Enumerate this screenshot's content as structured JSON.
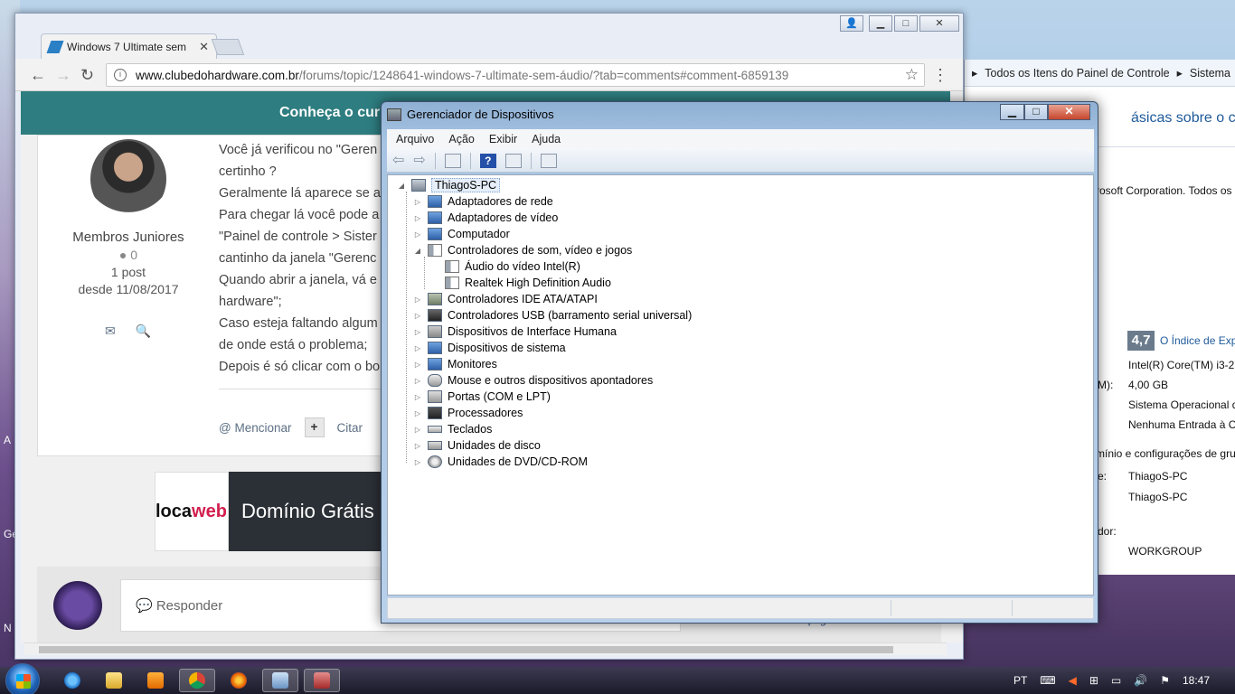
{
  "desktop": {
    "edge_labels": [
      "A",
      "Ge",
      "N"
    ]
  },
  "chrome": {
    "tab_title": "Windows 7 Ultimate sem",
    "tab_close": "✕",
    "url_host": "www.clubedohardware.com.br",
    "url_path": "/forums/topic/1248641-windows-7-ultimate-sem-áudio/?tab=comments#comment-6859139",
    "info_glyph": "i",
    "star_glyph": "☆",
    "menu_glyph": "⋮",
    "back_glyph": "←",
    "forward_glyph": "→",
    "reload_glyph": "↻",
    "win_user": "👤",
    "win_min": "▁",
    "win_max": "□",
    "win_close": "✕"
  },
  "page": {
    "banner_text": "Conheça o cur",
    "author": {
      "group": "Membros Juniores",
      "reputation": "0",
      "posts": "1 post",
      "since": "desde 11/08/2017",
      "mail_icon": "✉",
      "search_icon": "🔍"
    },
    "post_lines": [
      "Você já verificou no \"Geren",
      "certinho ?",
      "Geralmente lá aparece se a",
      "Para chegar lá você pode a",
      "\"Painel de controle > Sister",
      "cantinho da janela \"Gerenc",
      "Quando abrir a janela, vá e",
      "hardware\";",
      "Caso esteja faltando algum",
      "de onde está o problema;",
      "Depois é só clicar com o bo"
    ],
    "actions": {
      "mention": "@ Mencionar",
      "plus": "+",
      "quote": "Citar"
    },
    "ad": {
      "logo_a": "loca",
      "logo_b": "web",
      "slogan": "Domínio Grátis"
    },
    "reply_placeholder": "💬 Responder",
    "reply_extra": "da linha Rampage"
  },
  "control_panel": {
    "breadcrumb_1": "Todos os Itens do Painel de Controle",
    "breadcrumb_2": "Sistema",
    "heading": "ásicas sobre o compu",
    "copyright": "rosoft Corporation. Todos os",
    "index_score": "4,7",
    "index_link": "O Índice de Expe",
    "processor": "Intel(R) Core(TM) i3-21",
    "ram_label": "M):",
    "ram": "4,00 GB",
    "system_type": "Sistema Operacional d",
    "pen_touch": "Nenhuma Entrada à Ca",
    "domain_section": "mínio e configurações de gru",
    "computer_name_label": "e:",
    "computer_name": "ThiagoS-PC",
    "full_name": "ThiagoS-PC",
    "description_label": "dor:",
    "workgroup": "WORKGROUP"
  },
  "device_manager": {
    "title": "Gerenciador de Dispositivos",
    "min": "▁",
    "max": "□",
    "close": "✕",
    "menu": [
      "Arquivo",
      "Ação",
      "Exibir",
      "Ajuda"
    ],
    "toolbar_help": "?",
    "root": "ThiagoS-PC",
    "categories": [
      "Adaptadores de rede",
      "Adaptadores de vídeo",
      "Computador",
      "Controladores de som, vídeo e jogos",
      "Áudio do vídeo Intel(R)",
      "Realtek High Definition Audio",
      "Controladores IDE ATA/ATAPI",
      "Controladores USB (barramento serial universal)",
      "Dispositivos de Interface Humana",
      "Dispositivos de sistema",
      "Monitores",
      "Mouse e outros dispositivos apontadores",
      "Portas (COM e LPT)",
      "Processadores",
      "Teclados",
      "Unidades de disco",
      "Unidades de DVD/CD-ROM"
    ],
    "expander_collapsed": "▷",
    "expander_expanded": "◢"
  },
  "taskbar": {
    "lang": "PT",
    "clock": "18:47"
  }
}
